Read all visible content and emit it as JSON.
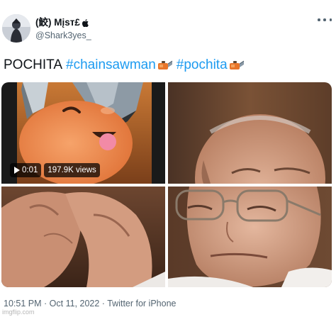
{
  "user": {
    "display_name": "(鮫) Mįsт£",
    "handle": "@Shark3yes_"
  },
  "tweet": {
    "text": "POCHITA",
    "hashtags": [
      "#chainsawman",
      "#pochita"
    ],
    "emoji_icon": "chainsaw-emoji-icon"
  },
  "media": {
    "video_time": "0:01",
    "video_views": "197.9K views"
  },
  "footer": {
    "time": "10:51 PM",
    "separator": "·",
    "date": "Oct 11, 2022",
    "source": "Twitter for iPhone"
  },
  "watermark": "imgflip.com",
  "colors": {
    "hashtag": "#1d9bf0",
    "secondary_text": "#536471",
    "primary_text": "#0f1419"
  }
}
